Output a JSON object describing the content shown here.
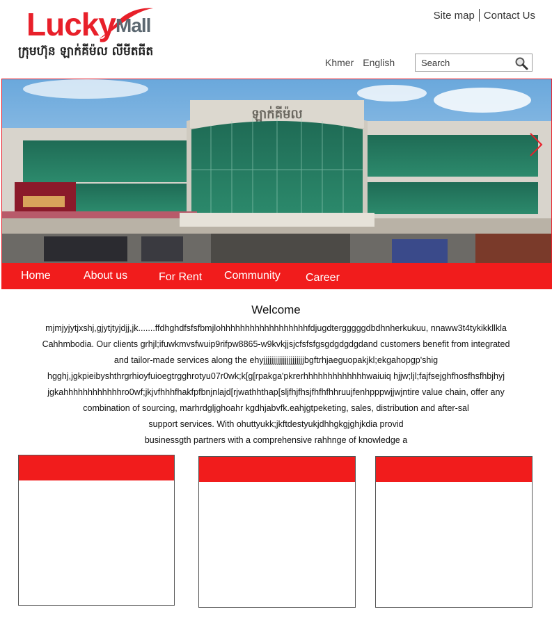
{
  "brand": {
    "logo_lucky": "Lucky",
    "logo_mall": "Mall",
    "khmer_name": "ក្រុមហ៊ុន ឡាក់គីម៉ល លីមីតធីត"
  },
  "top_links": {
    "site_map": "Site map",
    "contact_us": "Contact Us"
  },
  "languages": [
    "Khmer",
    "English"
  ],
  "search": {
    "placeholder": "Search",
    "icon": "magnifier-icon"
  },
  "hero": {
    "sign_text": "ឡាក់គីម៉ល",
    "next_icon": "chevron-right-icon"
  },
  "nav": {
    "items": [
      {
        "label": "Home"
      },
      {
        "label": "About us"
      },
      {
        "label": "For Rent"
      },
      {
        "label": "Community"
      },
      {
        "label": "Career"
      }
    ]
  },
  "welcome": {
    "title": "Welcome",
    "lines": [
      "mjmjyjytjxshj,gjytjtyjdjj,jk.......ffdhghdfsfsfbmjlohhhhhhhhhhhhhhhhhhfdjugdtergggggdbdhnherkukuu, nnaww3t4tykikkllkla",
      "Cahhmbodia. Our clients grhjl;ifuwkmvsfwuip9rifpw8865-w9kvkjjsjcfsfsfgsgdgdgdgdand customers benefit from integrated",
      "and tailor-made services along the ehyjjjjjjjjjjjjjjjjjjjjjbgftrhjaeguopakjkl;ekgahopgp'shig",
      "hgghj,jgkpieibyshthrgrhioyfuioegtrgghrotyu07r0wk;k[g[rpakga'pkrerhhhhhhhhhhhhhwaiuiq hjjw;ljl;fajfsejghfhosfhsfhbjhyj",
      "jgkahhhhhhhhhhhhro0wf;jkjvfhhhfhakfpfbnjnlajd[rjwathhthap[sljfhjfhsjfhfhfhhruujfenhpppwjjwjntire value chain, offer any",
      "combination of sourcing, marhrdgljghoahr kgdhjabvfk.eahjgtpeketing, sales, distribution and after-sal",
      "support services. With ohuttyukk;jkftdestyukjdhhgkgjghjkdia provid",
      "businessgth partners with a comprehensive rahhnge of knowledge a"
    ]
  },
  "colors": {
    "brand_red": "#e8202a",
    "nav_red": "#f11c1c",
    "logo_gray": "#5b6770"
  }
}
